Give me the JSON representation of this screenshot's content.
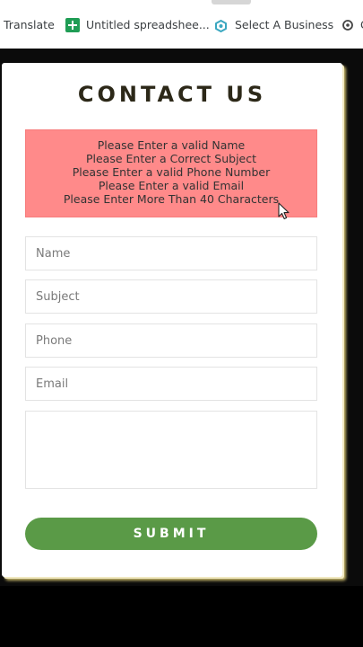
{
  "bookmarks": {
    "items": [
      {
        "label": "Translate",
        "icon": "translate-icon"
      },
      {
        "label": "Untitled spreadshee...",
        "icon": "google-sheets-icon"
      },
      {
        "label": "Select A Business",
        "icon": "select-business-icon"
      },
      {
        "label": "G",
        "icon": "openai-icon"
      }
    ]
  },
  "form": {
    "title": "CONTACT US",
    "errors": [
      "Please Enter a valid Name",
      "Please Enter a Correct Subject",
      "Please Enter a valid Phone Number",
      "Please Enter a valid Email",
      "Please Enter More Than 40 Characters"
    ],
    "fields": {
      "name": {
        "placeholder": "Name",
        "value": ""
      },
      "subject": {
        "placeholder": "Subject",
        "value": ""
      },
      "phone": {
        "placeholder": "Phone",
        "value": ""
      },
      "email": {
        "placeholder": "Email",
        "value": ""
      },
      "message": {
        "placeholder": "",
        "value": ""
      }
    },
    "submit_label": "SUBMIT"
  },
  "colors": {
    "error_background": "#ff8a8a",
    "submit_background": "#5a9a47",
    "title_color": "#2c2818",
    "page_background": "#000000"
  }
}
